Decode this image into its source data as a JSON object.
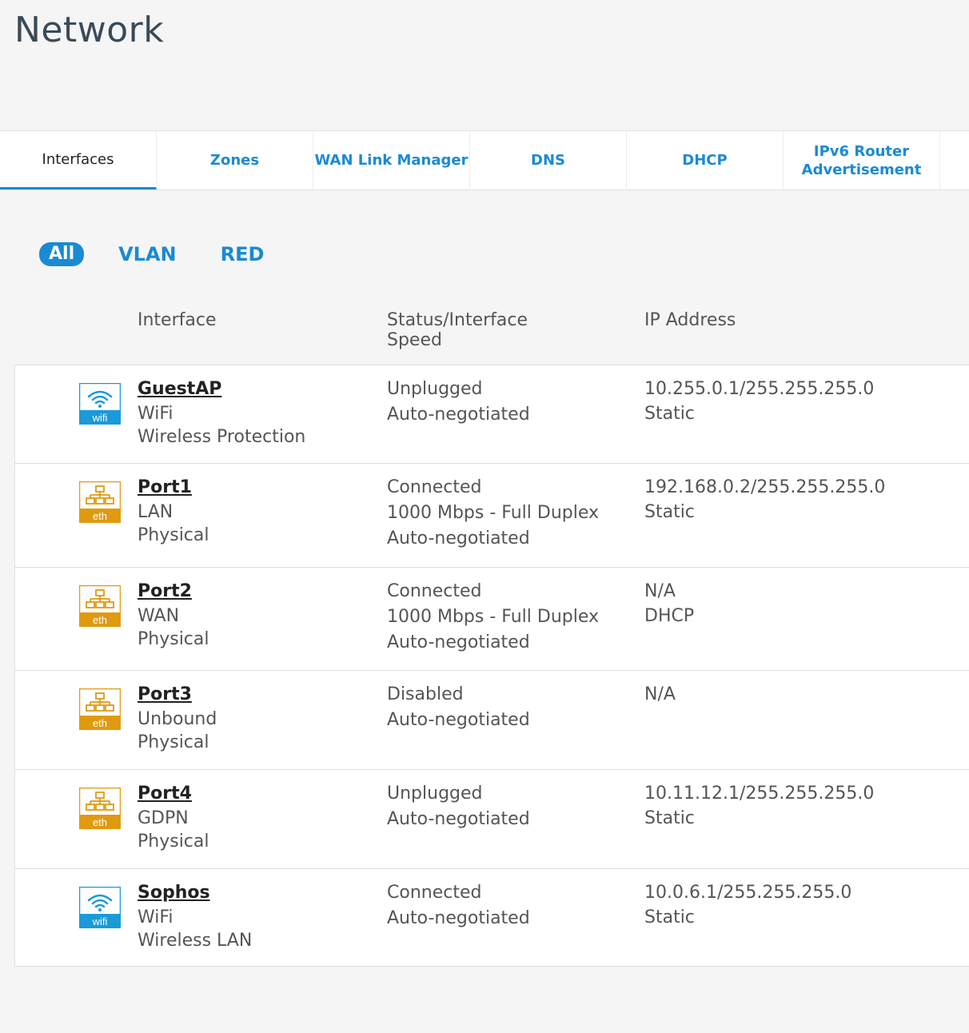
{
  "page_title": "Network",
  "tabs": [
    {
      "label": "Interfaces"
    },
    {
      "label": "Zones"
    },
    {
      "label": "WAN Link Manager"
    },
    {
      "label": "DNS"
    },
    {
      "label": "DHCP"
    },
    {
      "label": "IPv6 Router Advertisement"
    }
  ],
  "filters": [
    "All",
    "VLAN",
    "RED"
  ],
  "columns": {
    "interface": "Interface",
    "status": "Status/Interface Speed",
    "ip": "IP Address"
  },
  "icons": {
    "wifi_label": "wifi",
    "eth_label": "eth",
    "wifi_color": "#1a9ad8",
    "eth_color": "#e09a10"
  },
  "rows": [
    {
      "icon": "wifi",
      "name": "GuestAP",
      "type": "WiFi",
      "sub": "Wireless Protection",
      "status": [
        "Unplugged",
        "Auto-negotiated"
      ],
      "ip": [
        "10.255.0.1/255.255.255.0",
        "Static"
      ]
    },
    {
      "icon": "eth",
      "name": "Port1",
      "type": "LAN",
      "sub": "Physical",
      "status": [
        "Connected",
        "1000 Mbps - Full Duplex",
        "Auto-negotiated"
      ],
      "ip": [
        "192.168.0.2/255.255.255.0",
        "Static"
      ]
    },
    {
      "icon": "eth",
      "name": "Port2",
      "type": "WAN",
      "sub": "Physical",
      "status": [
        "Connected",
        "1000 Mbps - Full Duplex",
        "Auto-negotiated"
      ],
      "ip": [
        "N/A",
        "DHCP"
      ]
    },
    {
      "icon": "eth",
      "name": "Port3",
      "type": "Unbound",
      "sub": "Physical",
      "status": [
        "Disabled",
        "Auto-negotiated"
      ],
      "ip": [
        "N/A"
      ]
    },
    {
      "icon": "eth",
      "name": "Port4",
      "type": "GDPN",
      "sub": "Physical",
      "status": [
        "Unplugged",
        "Auto-negotiated"
      ],
      "ip": [
        "10.11.12.1/255.255.255.0",
        "Static"
      ]
    },
    {
      "icon": "wifi",
      "name": "Sophos",
      "type": "WiFi",
      "sub": "Wireless LAN",
      "status": [
        "Connected",
        "Auto-negotiated"
      ],
      "ip": [
        "10.0.6.1/255.255.255.0",
        "Static"
      ]
    }
  ]
}
